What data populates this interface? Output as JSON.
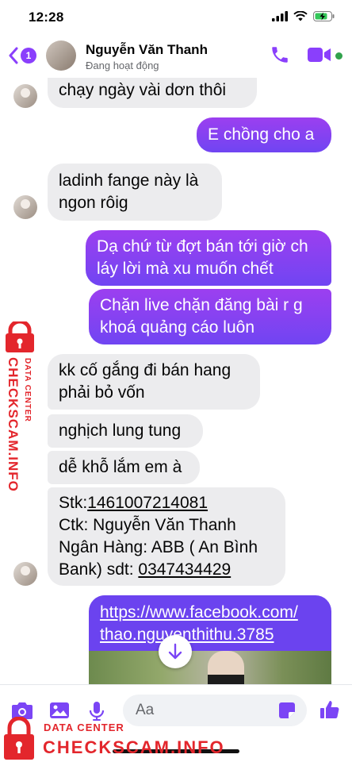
{
  "status_bar": {
    "time": "12:28"
  },
  "header": {
    "unread_count": "1",
    "contact_name": "Nguyễn Văn Thanh",
    "contact_status": "Đang hoạt động"
  },
  "messages": [
    {
      "direction": "in",
      "lines": [
        "chạy ngày vài dơn thôi"
      ]
    },
    {
      "direction": "out",
      "lines": [
        "E chồng cho a"
      ]
    },
    {
      "direction": "in",
      "lines": [
        "ladinh fange này là",
        "ngon rôig"
      ]
    },
    {
      "direction": "out",
      "lines": [
        "Dạ chứ từ đợt bán tới giờ ch",
        "láy lời mà xu muốn chết"
      ]
    },
    {
      "direction": "out",
      "lines": [
        "Chặn live chặn đăng bài r g",
        "khoá quảng cáo luôn"
      ]
    },
    {
      "direction": "in",
      "lines": [
        "kk cố gắng đi bán hang",
        "phải bỏ vốn"
      ]
    },
    {
      "direction": "in",
      "lines": [
        "nghịch lung tung"
      ]
    },
    {
      "direction": "in",
      "lines": [
        "dễ khỗ lắm em à"
      ]
    },
    {
      "direction": "in",
      "account_label": "Stk:",
      "account_number": "1461007214081",
      "holder_line": "Ctk: Nguyễn Văn Thanh",
      "bank_line": "Ngân Hàng: ABB ( An Bình",
      "phone_label": "Bank)  sdt: ",
      "phone_number": "0347434429"
    },
    {
      "direction": "out",
      "type": "link",
      "lines": [
        "https://www.facebook.com/",
        "thao.nguyenthithu.3785"
      ]
    }
  ],
  "composer": {
    "placeholder": "Aa"
  },
  "watermark": {
    "label": "DATA CENTER",
    "brand": "CHECKSCAM.INFO"
  },
  "colors": {
    "accent": "#8a3ffc",
    "outgoing_top": "#9c3ff0",
    "outgoing_bottom": "#7045f2",
    "incoming": "#ececee",
    "online": "#31a24c",
    "watermark": "#e3262c"
  },
  "icons": [
    "back-chevron-icon",
    "phone-icon",
    "video-camera-icon",
    "camera-icon",
    "gallery-icon",
    "microphone-icon",
    "sticker-icon",
    "like-icon",
    "arrow-down-icon",
    "lock-icon"
  ]
}
